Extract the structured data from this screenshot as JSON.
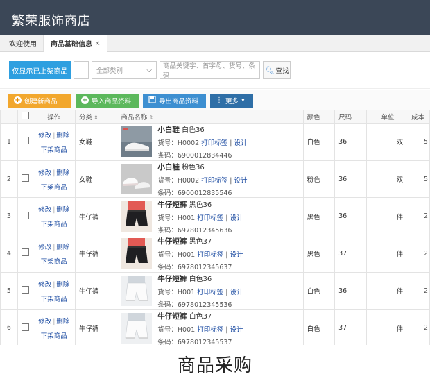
{
  "app": {
    "title": "繁荣服饰商店"
  },
  "tabs": [
    {
      "label": "欢迎使用"
    },
    {
      "label": "商品基础信息",
      "close": "×"
    }
  ],
  "search": {
    "only_on_sale_button": "仅显示已上架商品",
    "category_select": "全部类别",
    "keyword_placeholder": "商品关键字、首字母、货号、条码",
    "find_button": "查找"
  },
  "toolbar": {
    "create": "创建新商品",
    "import": "导入商品资料",
    "export": "导出商品资料",
    "more": "更多"
  },
  "columns": {
    "op": "操作",
    "category": "分类",
    "name": "商品名称",
    "color": "颜色",
    "size": "尺码",
    "unit": "单位",
    "cost": "成本"
  },
  "row_actions": {
    "edit": "修改",
    "delete": "删除",
    "off_shelf": "下架商品",
    "sku_prefix": "货号：",
    "print_label": "打印标签",
    "design": "设计",
    "barcode_prefix": "条码："
  },
  "rows": [
    {
      "idx": "1",
      "category": "女鞋",
      "name": "小白鞋",
      "variant": "白色36",
      "sku": "H0002",
      "barcode": "6900012834446",
      "color": "白色",
      "size": "36",
      "unit": "双",
      "cost": "5"
    },
    {
      "idx": "2",
      "category": "女鞋",
      "name": "小白鞋",
      "variant": "粉色36",
      "sku": "H0002",
      "barcode": "6900012835546",
      "color": "粉色",
      "size": "36",
      "unit": "双",
      "cost": "5"
    },
    {
      "idx": "3",
      "category": "牛仔裤",
      "name": "牛仔短裤",
      "variant": "黑色36",
      "sku": "H001",
      "barcode": "6978012345636",
      "color": "黑色",
      "size": "36",
      "unit": "件",
      "cost": "2"
    },
    {
      "idx": "4",
      "category": "牛仔裤",
      "name": "牛仔短裤",
      "variant": "黑色37",
      "sku": "H001",
      "barcode": "6978012345637",
      "color": "黑色",
      "size": "37",
      "unit": "件",
      "cost": "2"
    },
    {
      "idx": "5",
      "category": "牛仔裤",
      "name": "牛仔短裤",
      "variant": "白色36",
      "sku": "H001",
      "barcode": "6978012345536",
      "color": "白色",
      "size": "36",
      "unit": "件",
      "cost": "2"
    },
    {
      "idx": "6",
      "category": "牛仔裤",
      "name": "牛仔短裤",
      "variant": "白色37",
      "sku": "H001",
      "barcode": "6978012345537",
      "color": "白色",
      "size": "37",
      "unit": "件",
      "cost": "2"
    }
  ],
  "caption": "商品采购"
}
